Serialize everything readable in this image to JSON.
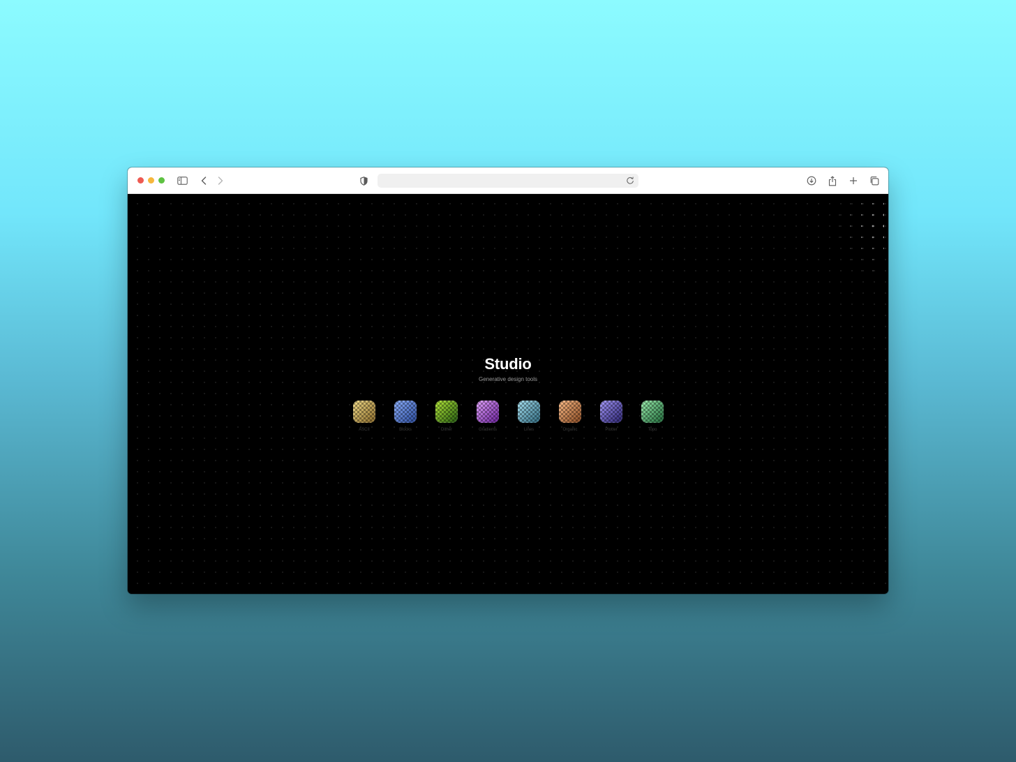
{
  "window": {
    "url": ""
  },
  "page": {
    "title": "Studio",
    "subtitle": "Generative design tools"
  },
  "tools": [
    {
      "label": "ASCII",
      "color_a": "#f3dd8a",
      "color_b": "#8a6a2a"
    },
    {
      "label": "Blocks",
      "color_a": "#8fb2ff",
      "color_b": "#2a4a9c"
    },
    {
      "label": "Dither",
      "color_a": "#b6ea3a",
      "color_b": "#245c12"
    },
    {
      "label": "Gradients",
      "color_a": "#e5a6ff",
      "color_b": "#6a1f9c"
    },
    {
      "label": "Lines",
      "color_a": "#a9e3f3",
      "color_b": "#2f6a80"
    },
    {
      "label": "Organic",
      "color_a": "#ffbf8a",
      "color_b": "#8a4a22"
    },
    {
      "label": "Plotter",
      "color_a": "#a89cff",
      "color_b": "#2a2270"
    },
    {
      "label": "Topo",
      "color_a": "#9ef0b0",
      "color_b": "#1f6a3a"
    }
  ],
  "icons": {
    "sidebar": "sidebar-icon",
    "back": "chevron-left-icon",
    "forward": "chevron-right-icon",
    "shield": "shield-icon",
    "reload": "reload-icon",
    "download": "download-icon",
    "share": "share-icon",
    "new_tab": "plus-icon",
    "tabs": "tab-overview-icon"
  }
}
